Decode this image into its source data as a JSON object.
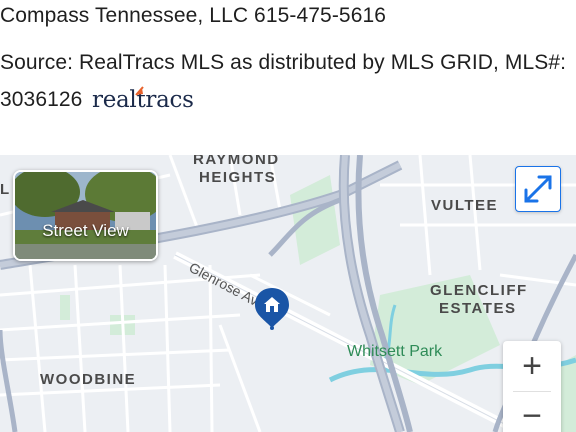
{
  "listing": {
    "brokerage_line": "Compass Tennessee, LLC 615-475-5616",
    "source_line": "Source: RealTracs MLS as distributed by MLS GRID,  MLS#:",
    "mls_number": "3036126",
    "logo_text": "realtracs"
  },
  "map": {
    "labels": {
      "raymond_1": "RAYMOND",
      "raymond_2": "HEIGHTS",
      "vultee": "VULTEE",
      "glencliff_1": "GLENCLIFF",
      "glencliff_2": "ESTATES",
      "woodbine": "WOODBINE",
      "cut_label": "L",
      "park": "Whitsett Park",
      "road": "Glenrose Ave"
    },
    "street_view_label": "Street View",
    "zoom_in_label": "+",
    "zoom_out_label": "−",
    "icons": {
      "expand": "expand-arrows-icon",
      "pin": "home-pin-icon",
      "logo_mark": "arrow-check-icon"
    },
    "colors": {
      "land": "#eceff3",
      "roads": "#ffffff",
      "highway": "#a9b4c8",
      "park": "#cfe9d6",
      "water": "#7fcfe0",
      "pin": "#1a55a6",
      "accent": "#1a73e8"
    }
  }
}
